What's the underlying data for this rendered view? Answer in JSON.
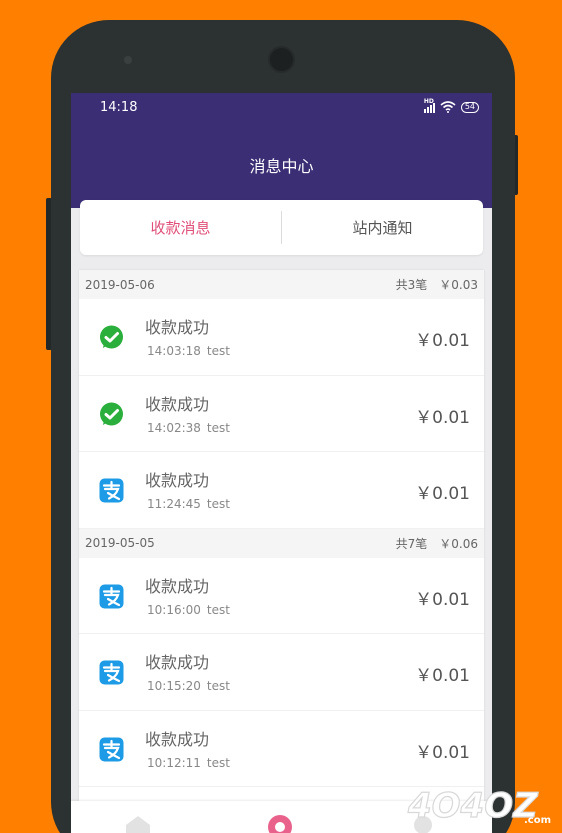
{
  "status_bar": {
    "time": "14:18",
    "network": "HD",
    "battery": "54"
  },
  "header": {
    "title": "消息中心"
  },
  "tabs": [
    {
      "label": "收款消息",
      "active": true
    },
    {
      "label": "站内通知",
      "active": false
    }
  ],
  "groups": [
    {
      "date": "2019-05-06",
      "count": "共3笔",
      "total": "￥0.03",
      "items": [
        {
          "icon": "wechat-pay-icon",
          "title": "收款成功",
          "time": "14:03:18",
          "note": "test",
          "amount": "￥0.01"
        },
        {
          "icon": "wechat-pay-icon",
          "title": "收款成功",
          "time": "14:02:38",
          "note": "test",
          "amount": "￥0.01"
        },
        {
          "icon": "alipay-icon",
          "title": "收款成功",
          "time": "11:24:45",
          "note": "test",
          "amount": "￥0.01"
        }
      ]
    },
    {
      "date": "2019-05-05",
      "count": "共7笔",
      "total": "￥0.06",
      "items": [
        {
          "icon": "alipay-icon",
          "title": "收款成功",
          "time": "10:16:00",
          "note": "test",
          "amount": "￥0.01"
        },
        {
          "icon": "alipay-icon",
          "title": "收款成功",
          "time": "10:15:20",
          "note": "test",
          "amount": "￥0.01"
        },
        {
          "icon": "alipay-icon",
          "title": "收款成功",
          "time": "10:12:11",
          "note": "test",
          "amount": "￥0.01"
        }
      ]
    }
  ],
  "watermark": "4O4OZ.com",
  "colors": {
    "page_bg": "#ff8000",
    "header_bg": "#3b2e75",
    "active_tab": "#e04f79",
    "wechat_green": "#2aae3c",
    "alipay_blue": "#1e9be6"
  }
}
